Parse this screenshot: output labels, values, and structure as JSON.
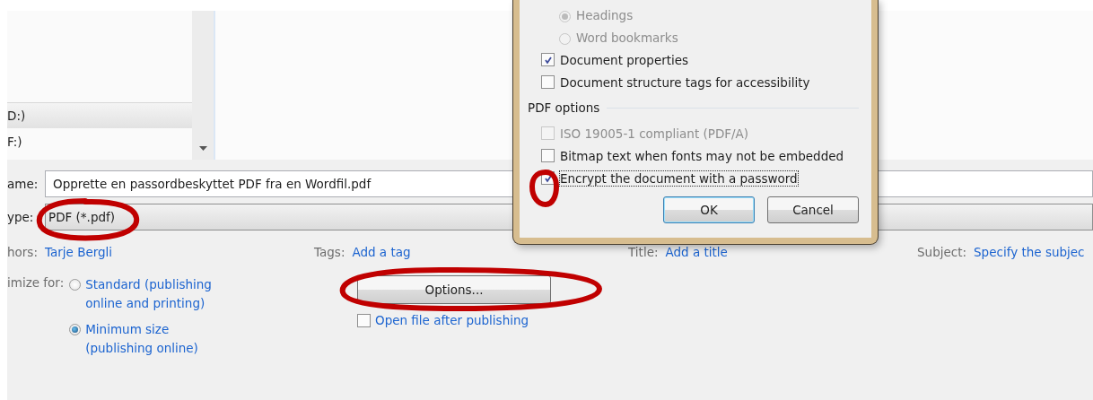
{
  "nav_pane": {
    "items": [
      {
        "label": "D:)",
        "selected": true
      },
      {
        "label": "F:)",
        "selected": false
      }
    ]
  },
  "file_name": {
    "label": "ame:",
    "value": "Opprette en passordbeskyttet PDF fra en Wordfil.pdf"
  },
  "save_as_type": {
    "label": "ype:",
    "value": "PDF (*.pdf)"
  },
  "metadata": [
    {
      "label": "hors:",
      "value": "Tarje Bergli"
    },
    {
      "label": "Tags:",
      "value": "Add a tag"
    },
    {
      "label": "Title:",
      "value": "Add a title"
    },
    {
      "label": "Subject:",
      "value": "Specify the subjec"
    }
  ],
  "optimize": {
    "label": "imize for:",
    "options": [
      {
        "label": "Standard (publishing online and printing)",
        "selected": false
      },
      {
        "label": "Minimum size (publishing online)",
        "selected": true
      }
    ]
  },
  "options_button": "Options...",
  "open_after": {
    "label": "Open file after publishing",
    "checked": false
  },
  "dialog": {
    "items": [
      {
        "kind": "radio",
        "label": "Headings",
        "selected": true,
        "disabled": true
      },
      {
        "kind": "radio",
        "label": "Word bookmarks",
        "selected": false,
        "disabled": true
      },
      {
        "kind": "checkbox",
        "label": "Document properties",
        "checked": true,
        "disabled": false
      },
      {
        "kind": "checkbox",
        "label": "Document structure tags for accessibility",
        "checked": false,
        "disabled": false
      },
      {
        "kind": "header",
        "label": "PDF options"
      },
      {
        "kind": "checkbox",
        "label": "ISO 19005-1 compliant (PDF/A)",
        "checked": false,
        "disabled": true
      },
      {
        "kind": "checkbox",
        "label": "Bitmap text when fonts may not be embedded",
        "checked": false,
        "disabled": false
      },
      {
        "kind": "checkbox",
        "label": "Encrypt the document with a password",
        "checked": true,
        "disabled": false
      }
    ],
    "buttons": [
      "OK",
      "Cancel"
    ]
  }
}
